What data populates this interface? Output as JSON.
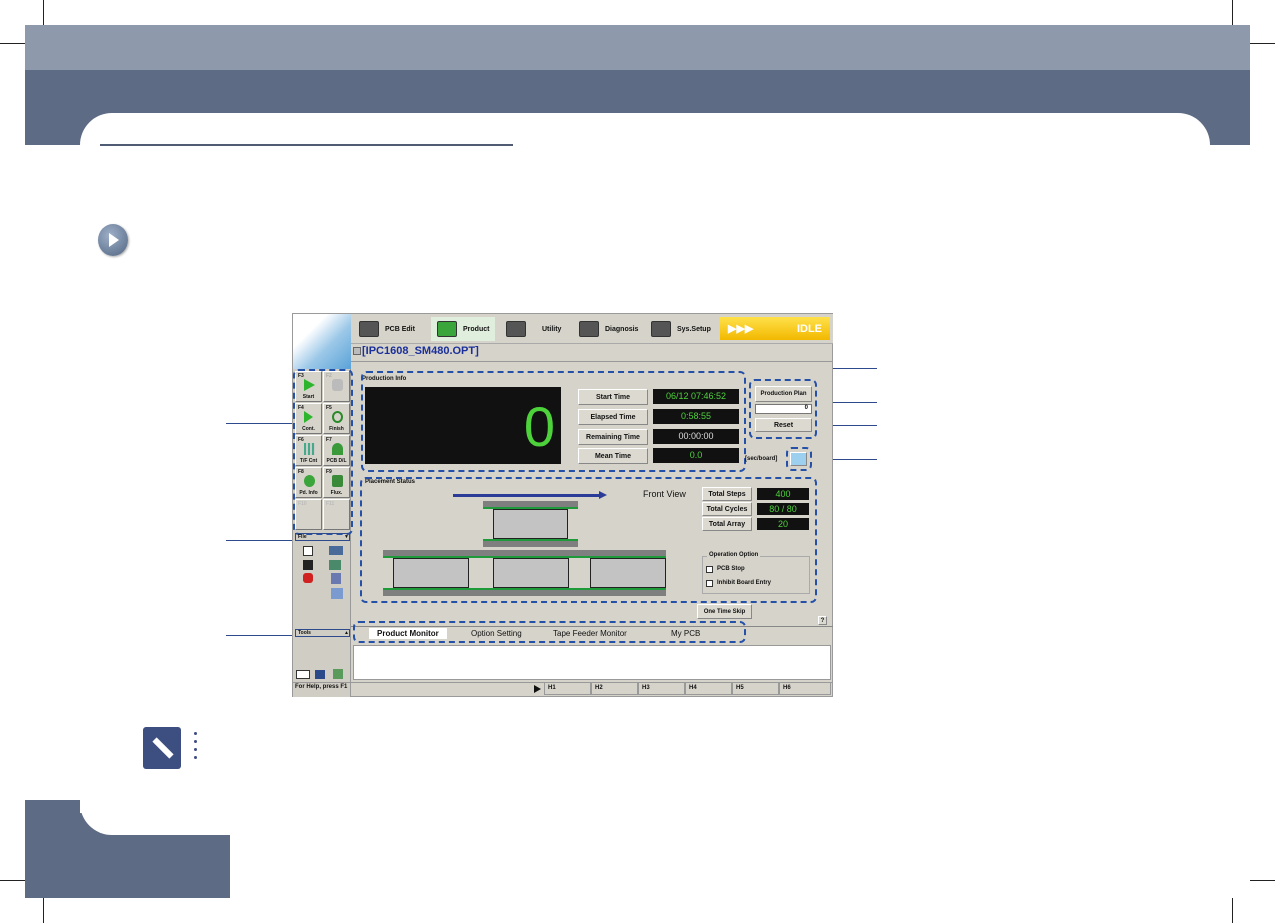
{
  "app": {
    "toolbar": [
      {
        "label": "PCB Edit",
        "icon": "pcb-edit-icon"
      },
      {
        "label": "Product",
        "icon": "product-gear-icon"
      },
      {
        "label": "Utility",
        "icon": "utility-icon"
      },
      {
        "label": "Diagnosis",
        "icon": "diagnosis-icon"
      },
      {
        "label": "Sys.Setup",
        "icon": "sys-setup-icon"
      }
    ],
    "status": {
      "arrows": "▶▶▶",
      "state": "IDLE",
      "color": "#f5c400"
    },
    "file_name": "[IPC1608_SM480.OPT]",
    "fkeys": [
      {
        "key": "F3",
        "label": "Start"
      },
      {
        "key": "F2",
        "label": ""
      },
      {
        "key": "F4",
        "label": "Cont."
      },
      {
        "key": "F5",
        "label": "Finish"
      },
      {
        "key": "F6",
        "label": "T/F Cnt"
      },
      {
        "key": "F7",
        "label": "PCB D/L"
      },
      {
        "key": "F8",
        "label": "Pd. Info"
      },
      {
        "key": "F9",
        "label": "Flux."
      },
      {
        "key": "F10",
        "label": ""
      },
      {
        "key": "F11",
        "label": ""
      }
    ],
    "file_panel": "File",
    "tools_panel": "Tools",
    "production_info": {
      "title": "Production Info",
      "count": "0",
      "rows": [
        {
          "label": "Start Time",
          "value": "06/12 07:46:52"
        },
        {
          "label": "Elapsed Time",
          "value": "0:58:55"
        },
        {
          "label": "Remaining Time",
          "value": "00:00:00"
        },
        {
          "label": "Mean Time",
          "value": "0.0"
        }
      ],
      "unit": "[sec/board]"
    },
    "production_plan": {
      "label": "Production Plan",
      "value": "0",
      "reset": "Reset"
    },
    "placement": {
      "title": "Placement Status",
      "view": "Front View",
      "stats": [
        {
          "label": "Total Steps",
          "value": "400"
        },
        {
          "label": "Total Cycles",
          "value": "80 / 80"
        },
        {
          "label": "Total Array",
          "value": "20"
        }
      ],
      "option_title": "Operation Option",
      "options": [
        {
          "label": "PCB Stop",
          "checked": false
        },
        {
          "label": "Inhibit Board Entry",
          "checked": false
        }
      ]
    },
    "one_time_skip": "One Time Skip",
    "help": "?",
    "tabs": [
      "Product Monitor",
      "Option Setting",
      "Tape Feeder Monitor",
      "My PCB"
    ],
    "statusbar": {
      "help": "For Help, press F1",
      "cells": [
        "H1",
        "H2",
        "H3",
        "H4",
        "H5",
        "H6"
      ]
    }
  }
}
